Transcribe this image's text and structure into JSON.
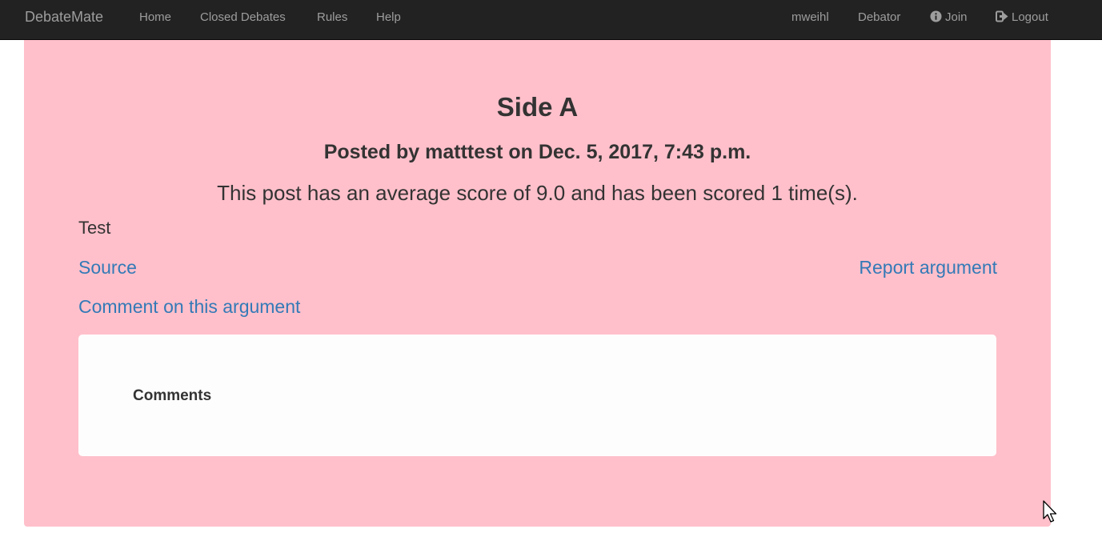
{
  "navbar": {
    "brand": "DebateMate",
    "links": [
      {
        "label": "Home"
      },
      {
        "label": "Closed Debates"
      },
      {
        "label": "Rules"
      },
      {
        "label": "Help"
      }
    ],
    "right_links": [
      {
        "label": "mweihl"
      },
      {
        "label": "Debator"
      },
      {
        "label": "Join",
        "icon": "info-circle-icon"
      },
      {
        "label": "Logout",
        "icon": "logout-icon"
      }
    ]
  },
  "argument": {
    "side_title": "Side A",
    "posted_by": "Posted by matttest on Dec. 5, 2017, 7:43 p.m.",
    "score_text": "This post has an average score of 9.0 and has been scored 1 time(s).",
    "body": "Test",
    "source_label": "Source",
    "report_label": "Report argument",
    "comment_label": "Comment on this argument"
  },
  "comments": {
    "title": "Comments"
  },
  "colors": {
    "navbar_bg": "#222222",
    "nav_text": "#9d9d9d",
    "panel_bg": "#ffc0cb",
    "link": "#337ab7",
    "text": "#333333"
  }
}
